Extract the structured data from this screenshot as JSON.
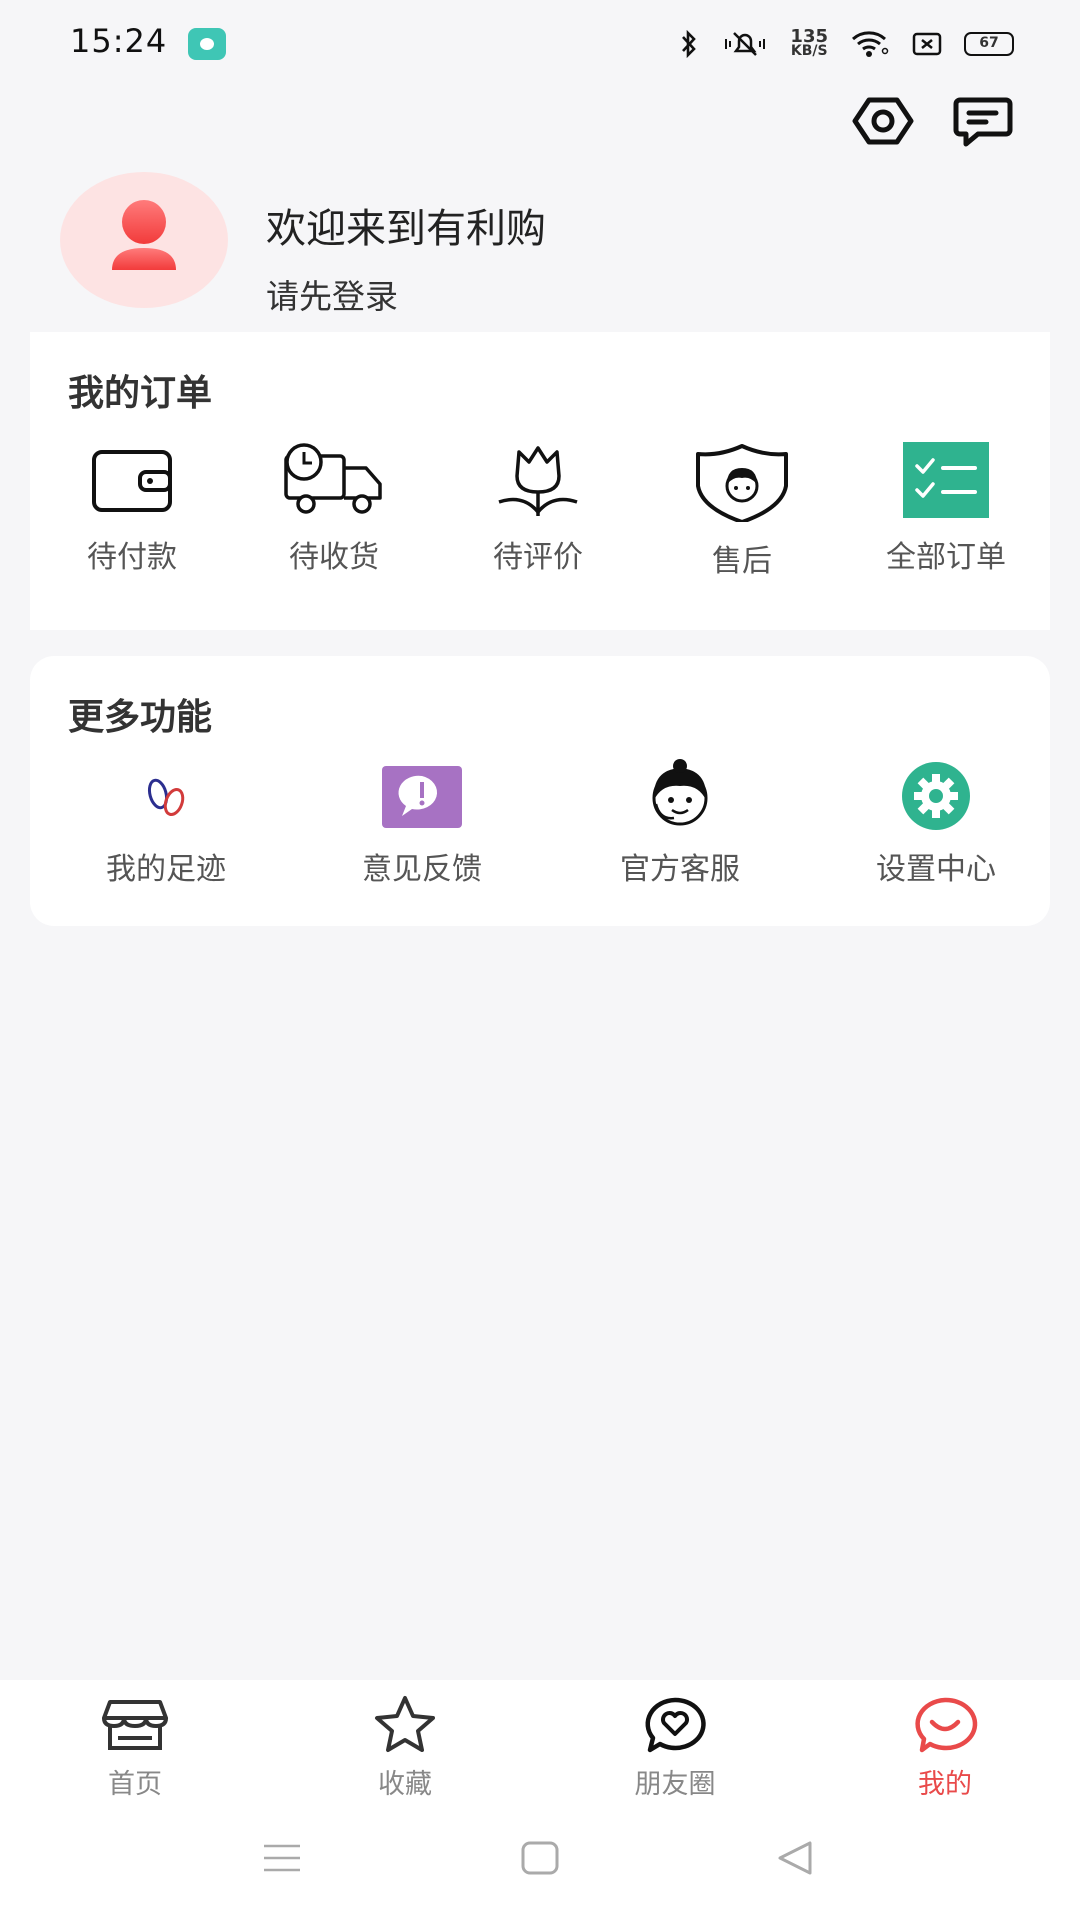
{
  "status_bar": {
    "time": "15:24",
    "net_speed_value": "135",
    "net_speed_unit": "KB/S",
    "battery": "67"
  },
  "header": {
    "icons": [
      "settings-hex-icon",
      "message-icon"
    ]
  },
  "profile": {
    "welcome": "欢迎来到有利购",
    "login_prompt": "请先登录"
  },
  "orders": {
    "title": "我的订单",
    "items": [
      {
        "label": "待付款",
        "icon": "wallet-icon"
      },
      {
        "label": "待收货",
        "icon": "delivery-truck-icon"
      },
      {
        "label": "待评价",
        "icon": "tulip-icon"
      },
      {
        "label": "售后",
        "icon": "service-shield-icon"
      },
      {
        "label": "全部订单",
        "icon": "checklist-icon"
      }
    ]
  },
  "more": {
    "title": "更多功能",
    "items": [
      {
        "label": "我的足迹",
        "icon": "footprint-icon"
      },
      {
        "label": "意见反馈",
        "icon": "feedback-icon"
      },
      {
        "label": "官方客服",
        "icon": "customer-service-icon"
      },
      {
        "label": "设置中心",
        "icon": "settings-gear-icon"
      }
    ]
  },
  "bottom_nav": {
    "items": [
      {
        "label": "首页",
        "icon": "store-icon"
      },
      {
        "label": "收藏",
        "icon": "star-icon"
      },
      {
        "label": "朋友圈",
        "icon": "heart-chat-icon"
      },
      {
        "label": "我的",
        "icon": "smile-chat-icon",
        "active": true
      }
    ]
  },
  "colors": {
    "accent": "#e94a4a",
    "green": "#2fb38f",
    "purple": "#a772c3",
    "background": "#f6f6f8"
  }
}
